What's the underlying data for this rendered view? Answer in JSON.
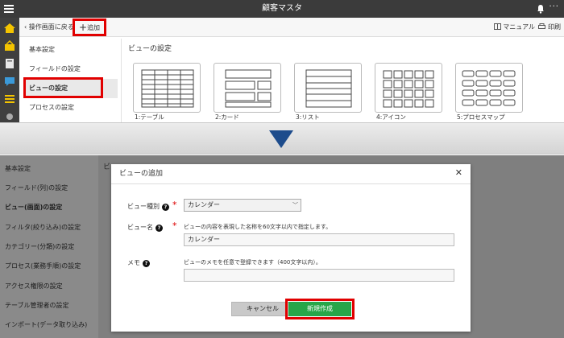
{
  "top": {
    "title": "顧客マスタ",
    "more_label": "···"
  },
  "toolbar": {
    "back_label": "操作画面に戻る",
    "add_label": "追加",
    "manual_label": "マニュアル",
    "print_label": "印刷"
  },
  "settings_menu": {
    "items": [
      "基本設定",
      "フィールドの設定",
      "ビューの設定",
      "プロセスの設定"
    ]
  },
  "view_panel": {
    "heading": "ビューの設定",
    "views": [
      "1:テーブル",
      "2:カード",
      "3:リスト",
      "4:アイコン",
      "5:プロセスマップ"
    ]
  },
  "bottom": {
    "sidebar_items": [
      "基本設定",
      "フィールド(列)の設定",
      "ビュー(画面)の設定",
      "フィルタ(絞り込み)の設定",
      "カテゴリー(分類)の設定",
      "プロセス(業務手順)の設定",
      "アクセス権限の設定",
      "テーブル管理者の設定",
      "インポート(データ取り込み)"
    ],
    "bg_heading": "ビ"
  },
  "dialog": {
    "title": "ビューの追加",
    "type_label": "ビュー種別",
    "type_value": "カレンダー",
    "name_label": "ビュー名",
    "name_hint": "ビューの内容を表現した名称を60文字以内で指定します。",
    "name_value": "カレンダー",
    "memo_label": "メモ",
    "memo_hint": "ビューのメモを任意で登録できます（400文字以内）。",
    "memo_value": "",
    "cancel_label": "キャンセル",
    "create_label": "新規作成"
  },
  "colors": {
    "highlight": "#e10000",
    "create_button": "#27a649",
    "arrow": "#1d4c8c"
  }
}
